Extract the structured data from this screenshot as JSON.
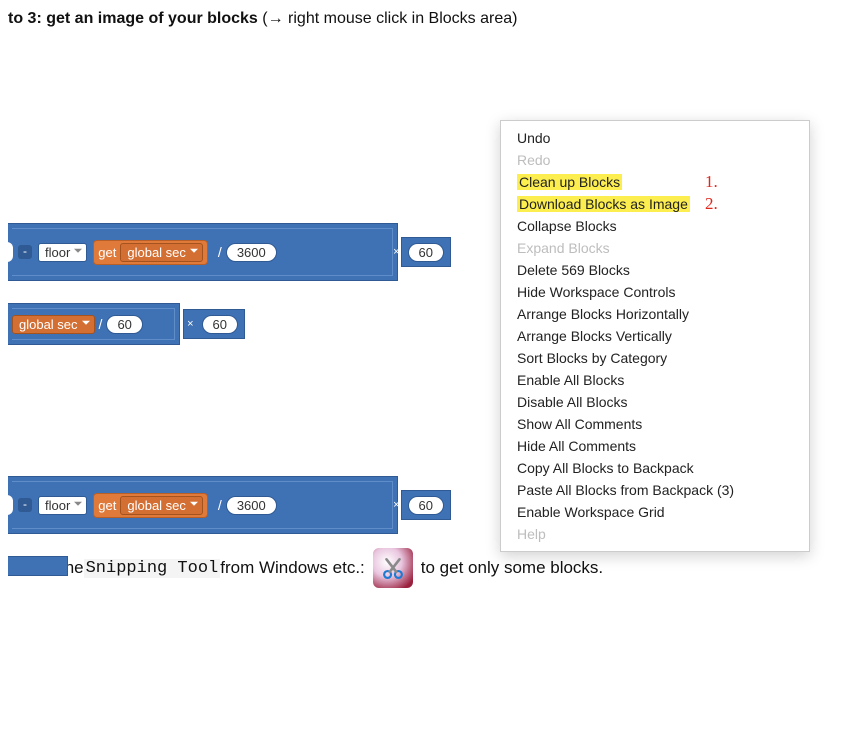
{
  "heading": {
    "bold": "to 3: get an image of your blocks",
    "rest": " (→ right mouse click in Blocks area)"
  },
  "blocks": {
    "floor_label": "floor",
    "get_label": "get",
    "global_sec_label": "global sec",
    "val_3600": "3600",
    "val_60": "60",
    "slash": "/",
    "minus": "-",
    "x": "×"
  },
  "menu": {
    "undo": "Undo",
    "redo": "Redo",
    "cleanup": "Clean up Blocks",
    "download": "Download Blocks as Image",
    "collapse": "Collapse Blocks",
    "expand": "Expand Blocks",
    "delete": "Delete 569 Blocks",
    "hidectrl": "Hide Workspace Controls",
    "arrh": "Arrange Blocks Horizontally",
    "arrv": "Arrange Blocks Vertically",
    "sort": "Sort Blocks by Category",
    "enable": "Enable All Blocks",
    "disable": "Disable All Blocks",
    "showc": "Show All Comments",
    "hidec": "Hide All Comments",
    "copybp": "Copy All Blocks to Backpack",
    "pastebp": "Paste All Blocks from Backpack (3)",
    "grid": "Enable Workspace Grid",
    "help": "Help",
    "anno1": "1.",
    "anno2": "2."
  },
  "footer": {
    "pre": "or use the ",
    "tool": "Snipping Tool",
    "mid": " from Windows etc.: ",
    "post": " to get only some blocks."
  }
}
